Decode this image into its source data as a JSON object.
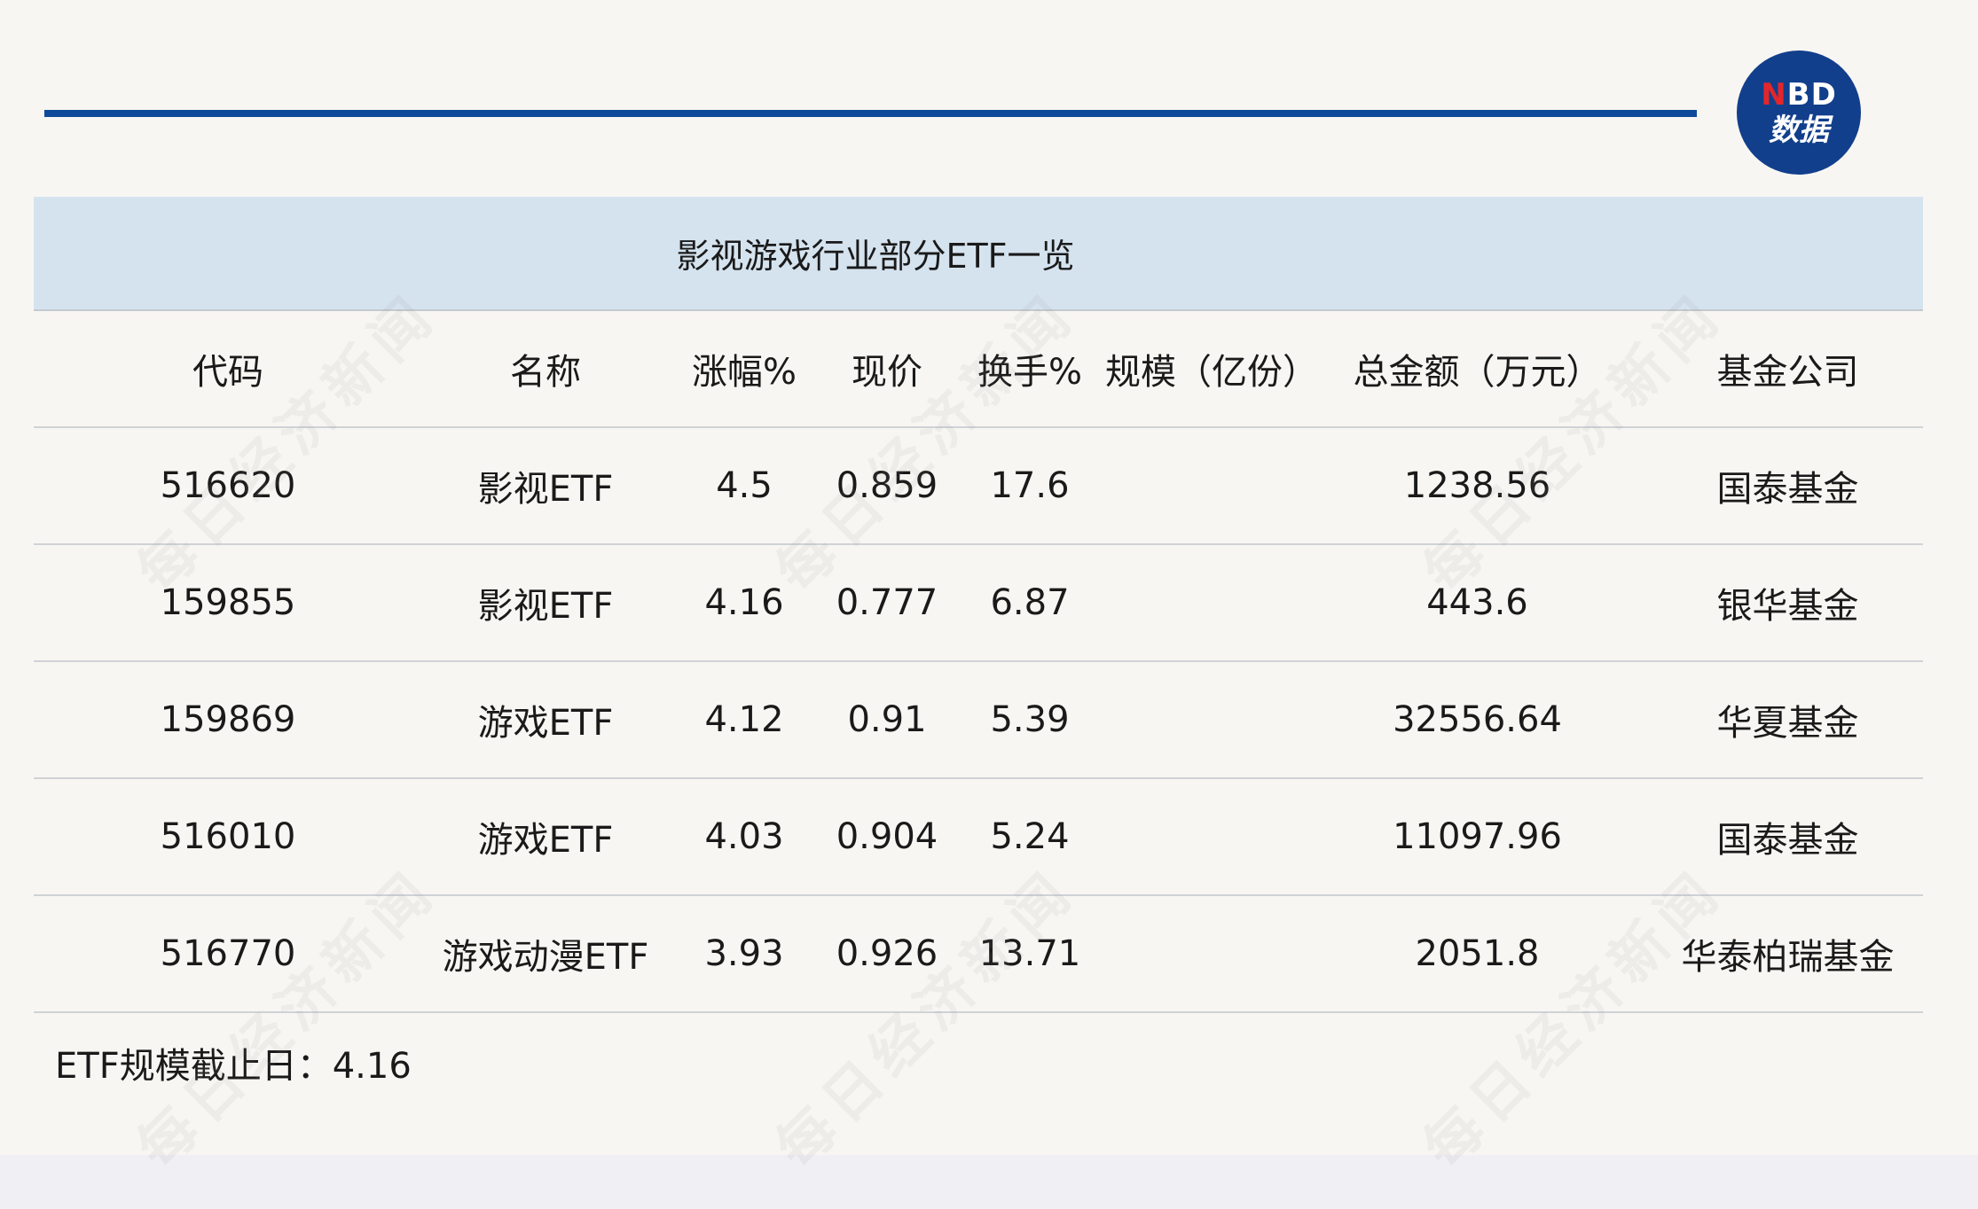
{
  "brand": {
    "logo_top_n": "N",
    "logo_top_rest": "BD",
    "logo_bottom": "数据"
  },
  "table": {
    "title": "影视游戏行业部分ETF一览",
    "headers": [
      "代码",
      "名称",
      "涨幅%",
      "现价",
      "换手%",
      "规模（亿份）",
      "总金额（万元）",
      "基金公司"
    ],
    "rows": [
      [
        "516620",
        "影视ETF",
        "4.5",
        "0.859",
        "17.6",
        "",
        "1238.56",
        "国泰基金"
      ],
      [
        "159855",
        "影视ETF",
        "4.16",
        "0.777",
        "6.87",
        "",
        "443.6",
        "银华基金"
      ],
      [
        "159869",
        "游戏ETF",
        "4.12",
        "0.91",
        "5.39",
        "",
        "32556.64",
        "华夏基金"
      ],
      [
        "516010",
        "游戏ETF",
        "4.03",
        "0.904",
        "5.24",
        "",
        "11097.96",
        "国泰基金"
      ],
      [
        "516770",
        "游戏动漫ETF",
        "3.93",
        "0.926",
        "13.71",
        "",
        "2051.8",
        "华泰柏瑞基金"
      ]
    ]
  },
  "footnote": "ETF规模截止日：4.16",
  "watermark": "每日经济新闻",
  "colors": {
    "accent_rule": "#0d4a9a",
    "title_band": "#d5e3ef",
    "logo_bg": "#123f8c",
    "logo_n": "#e3262b"
  }
}
